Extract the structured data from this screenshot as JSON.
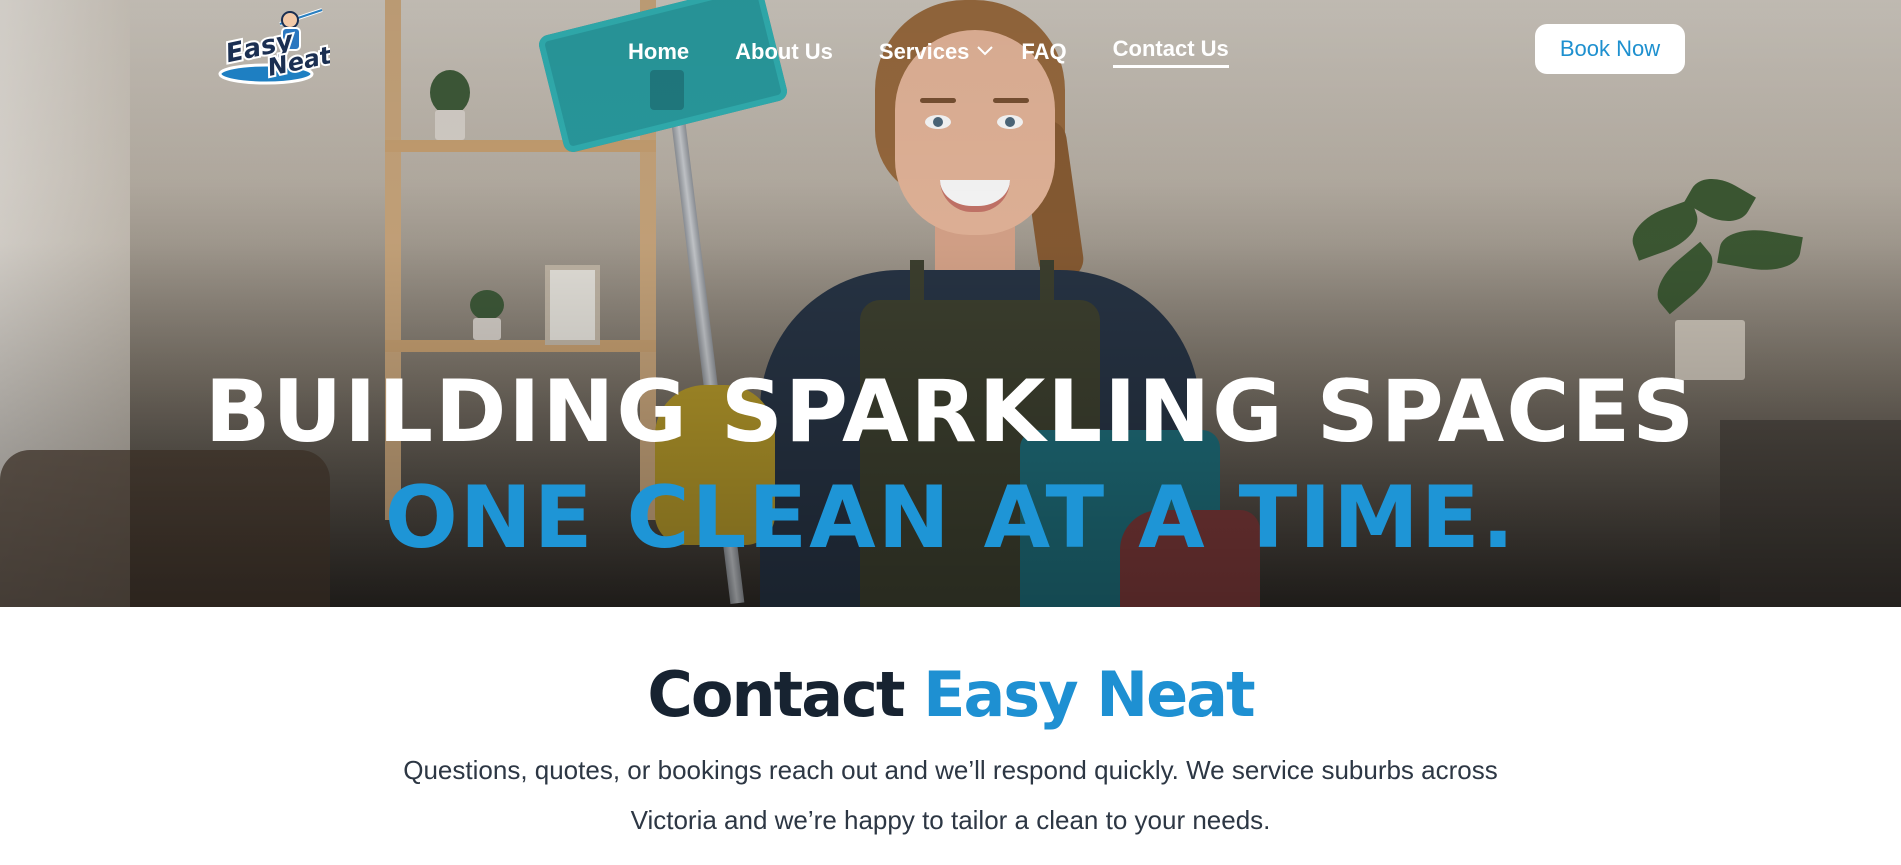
{
  "brand": {
    "logo_line1": "Easy",
    "logo_line2": "Neat"
  },
  "nav": {
    "items": [
      {
        "label": "Home"
      },
      {
        "label": "About Us"
      },
      {
        "label": "Services",
        "icon": "chevron-down-icon"
      },
      {
        "label": "FAQ"
      },
      {
        "label": "Contact Us",
        "active": true
      }
    ],
    "cta_label": "Book Now"
  },
  "hero": {
    "line1": "BUILDING SPARKLING SPACES",
    "line2": "ONE CLEAN AT A TIME."
  },
  "contact": {
    "title_part1": "Contact",
    "title_part2": "Easy Neat",
    "description": "Questions, quotes, or bookings reach out and we’ll respond quickly. We service suburbs across Victoria and we’re happy to tailor a clean to your needs."
  },
  "colors": {
    "accent": "#1e90d2",
    "heading_dark": "#172331",
    "text": "#2d3744"
  }
}
